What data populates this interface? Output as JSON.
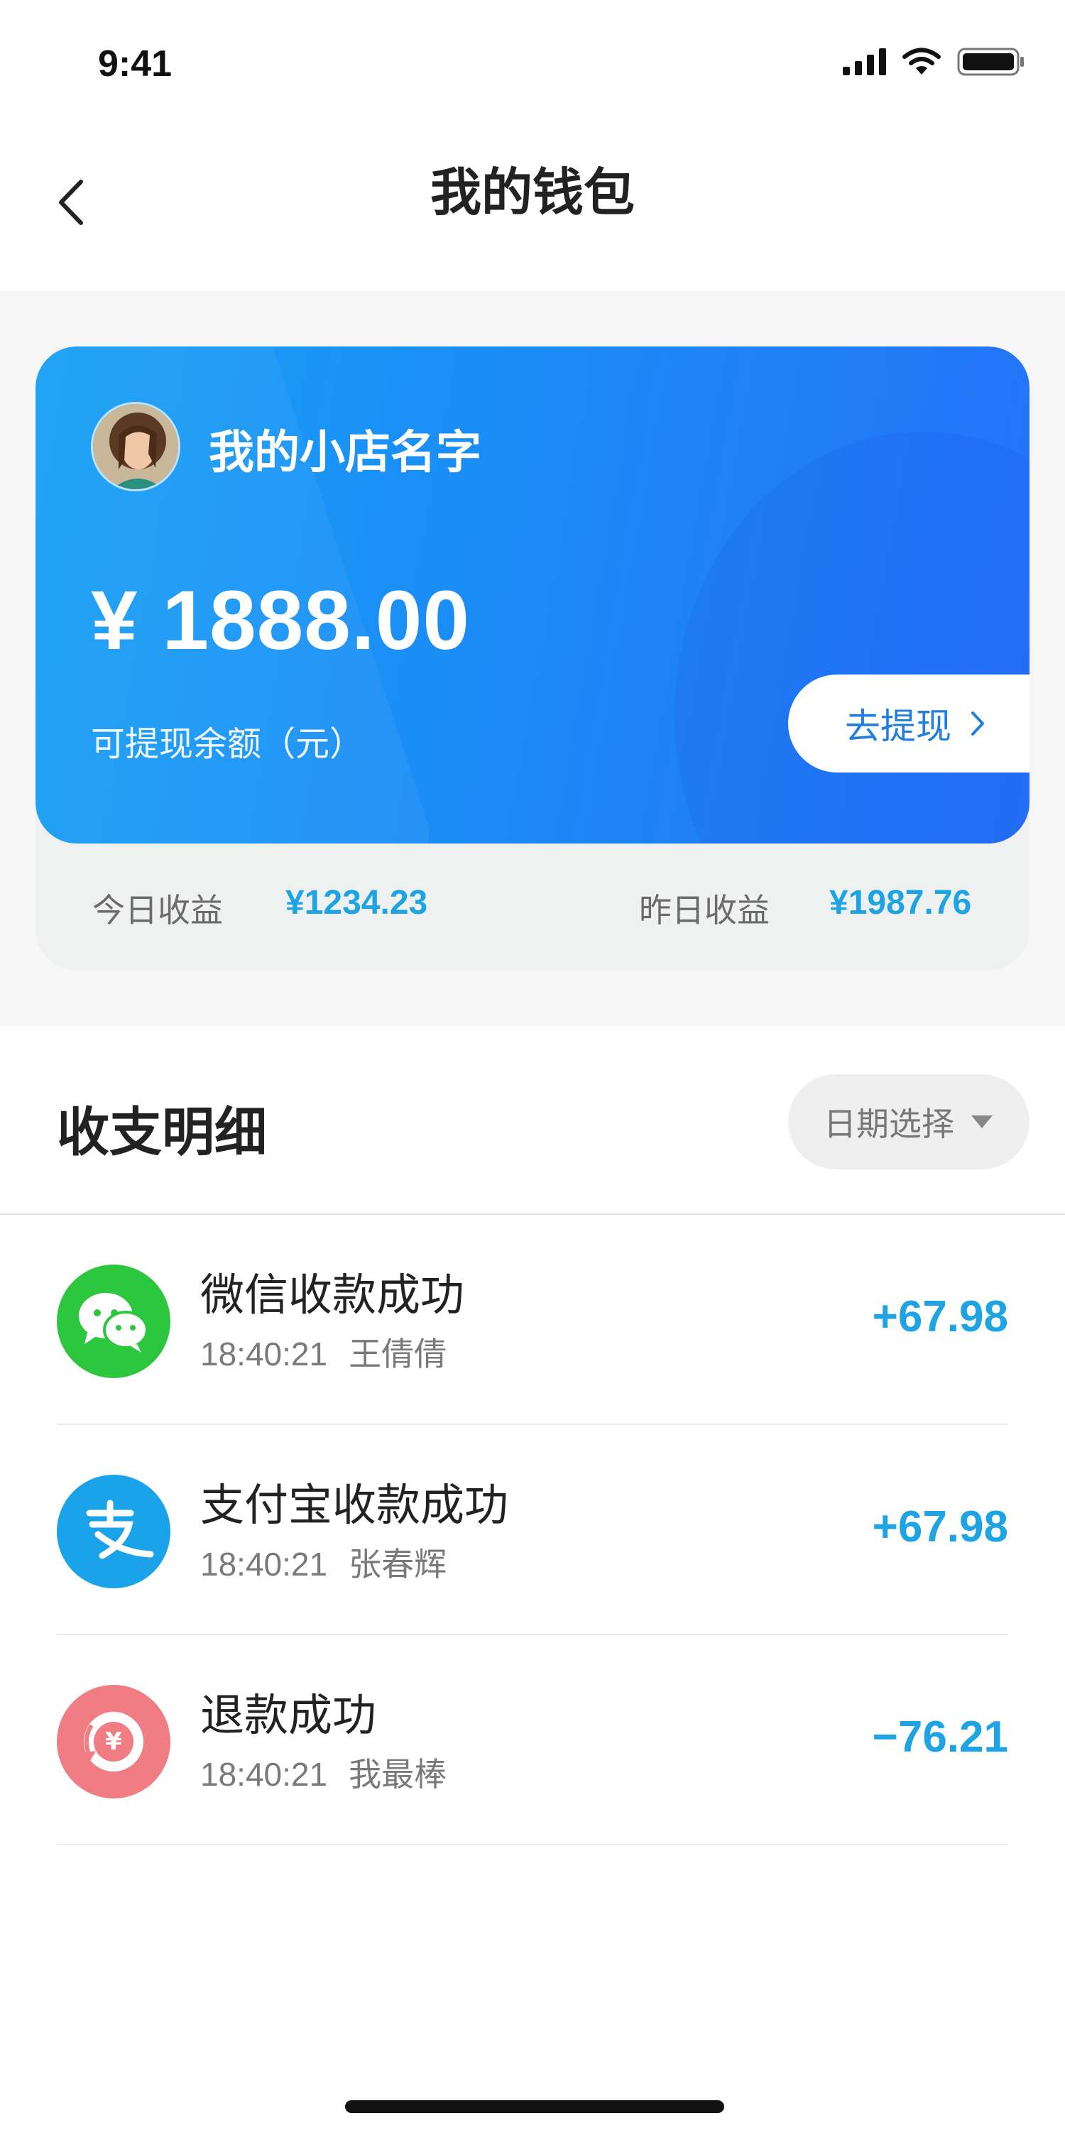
{
  "status_bar": {
    "time": "9:41"
  },
  "nav": {
    "title": "我的钱包"
  },
  "wallet": {
    "shop_name": "我的小店名字",
    "balance": "¥ 1888.00",
    "balance_label": "可提现余额（元）",
    "withdraw_label": "去提现",
    "today_label": "今日收益",
    "today_value": "¥1234.23",
    "yesterday_label": "昨日收益",
    "yesterday_value": "¥1987.76"
  },
  "details": {
    "title": "收支明细",
    "date_picker_label": "日期选择",
    "transactions": [
      {
        "icon": "wechat-icon",
        "title": "微信收款成功",
        "time": "18:40:21",
        "name": "王倩倩",
        "amount": "+67.98"
      },
      {
        "icon": "alipay-icon",
        "title": "支付宝收款成功",
        "time": "18:40:21",
        "name": "张春辉",
        "amount": "+67.98"
      },
      {
        "icon": "refund-icon",
        "title": "退款成功",
        "time": "18:40:21",
        "name": "我最棒",
        "amount": "−76.21"
      }
    ]
  },
  "colors": {
    "card_gradient_start": "#17a0f5",
    "card_gradient_end": "#2571f8",
    "amount": "#1ea4e4",
    "wechat": "#2dc63f",
    "alipay": "#1aa3e8",
    "refund": "#f07c84"
  }
}
